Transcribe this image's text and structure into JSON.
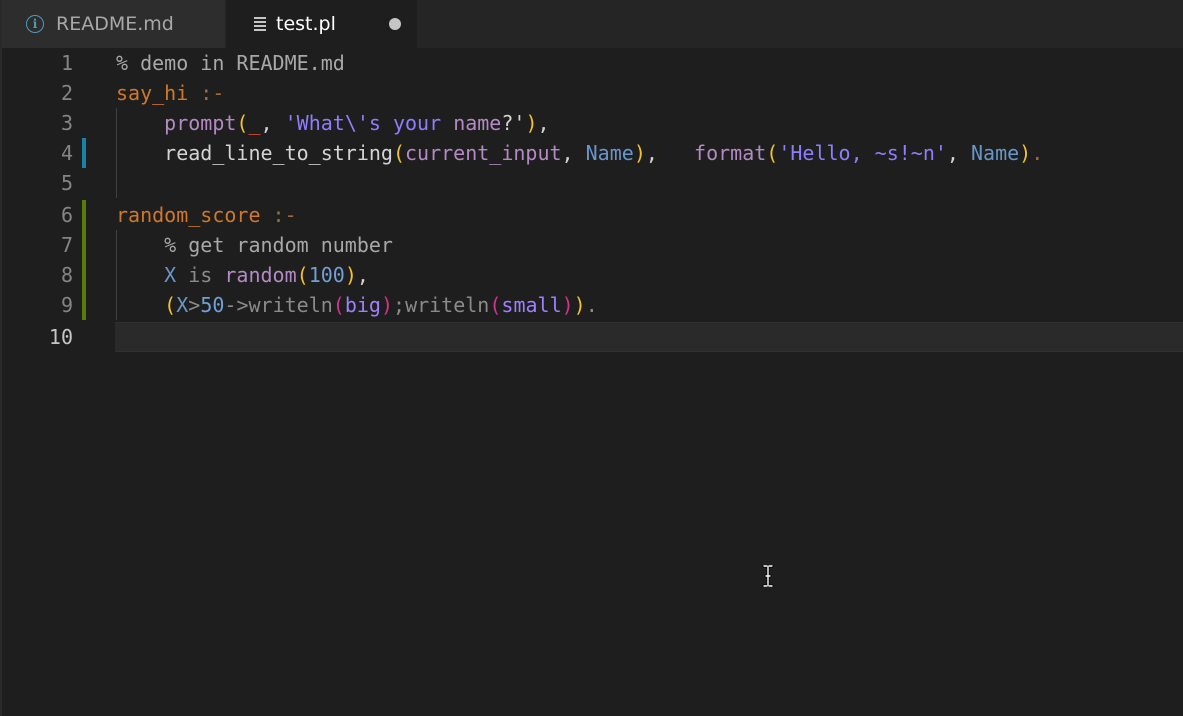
{
  "tabs": [
    {
      "label": "README.md",
      "icon": "info-icon",
      "active": false,
      "dirty": false
    },
    {
      "label": "test.pl",
      "icon": "lines-icon",
      "active": true,
      "dirty": true
    }
  ],
  "editor": {
    "line_numbers": [
      "1",
      "2",
      "3",
      "4",
      "5",
      "6",
      "7",
      "8",
      "9",
      "10"
    ],
    "current_line": "10",
    "gutter_colors": {
      "modified": "#1b81a8",
      "added": "#587c0c"
    },
    "lines": {
      "l1": {
        "comment": "% demo in README.md"
      },
      "l2": {
        "head": "say_hi",
        "op": " :-"
      },
      "l3": {
        "indent": "    ",
        "fn": "prompt",
        "p1": "(",
        "under": "_",
        "sep1": ", ",
        "str": "'What\\'s your ",
        "name": "name",
        "str_end": "?'",
        "p2": ")",
        "end": ","
      },
      "l4": {
        "indent": "    ",
        "fn": "read_line_to_string",
        "p1": "(",
        "arg1": "current_input",
        "sep1": ", ",
        "var1": "Name",
        "p2": ")",
        "sep2": ",   ",
        "fn2": "format",
        "p3": "(",
        "str": "'Hello, ~s!~n'",
        "sep3": ", ",
        "var2": "Name",
        "p4": ")",
        "end": "."
      },
      "l5": {
        "text": ""
      },
      "l6": {
        "head": "random_score",
        "op": " :-"
      },
      "l7": {
        "indent": "    ",
        "comment": "% get random number"
      },
      "l8": {
        "indent": "    ",
        "var": "X",
        "is": " is ",
        "fn": "random",
        "p1": "(",
        "num": "100",
        "p2": ")",
        "end": ","
      },
      "l9": {
        "indent": "    ",
        "p1": "(",
        "var": "X",
        "gt": ">",
        "num": "50",
        "arrow": "->",
        "fn1": "writeln",
        "p2": "(",
        "a1": "big",
        "p3": ")",
        "semi": ";",
        "fn2": "writeln",
        "p4": "(",
        "a2": "small",
        "p5": ")",
        "p6": ")",
        "end": "."
      }
    }
  }
}
